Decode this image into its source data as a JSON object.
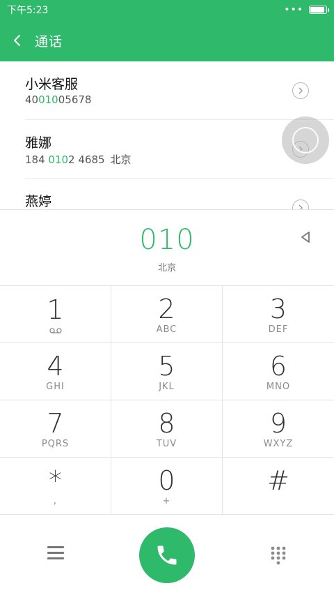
{
  "status_bar": {
    "time": "下午5:23",
    "dots": "•••",
    "battery_level": 0.85
  },
  "header": {
    "title": "通话"
  },
  "contacts": [
    {
      "name": "小米客服",
      "number_pre": "40",
      "number_hl": "010",
      "number_post": "05678",
      "location": ""
    },
    {
      "name": "雅娜",
      "number_pre": "184 ",
      "number_hl": "010",
      "number_post": "2 4685",
      "location": "北京"
    },
    {
      "name": "燕婷",
      "number_pre": "",
      "number_hl": "",
      "number_post": "",
      "location": ""
    }
  ],
  "dialed": {
    "number": "010",
    "region": "北京"
  },
  "keypad": [
    {
      "digit": "1",
      "letters": ""
    },
    {
      "digit": "2",
      "letters": "ABC"
    },
    {
      "digit": "3",
      "letters": "DEF"
    },
    {
      "digit": "4",
      "letters": "GHI"
    },
    {
      "digit": "5",
      "letters": "JKL"
    },
    {
      "digit": "6",
      "letters": "MNO"
    },
    {
      "digit": "7",
      "letters": "PQRS"
    },
    {
      "digit": "8",
      "letters": "TUV"
    },
    {
      "digit": "9",
      "letters": "WXYZ"
    },
    {
      "digit": "*",
      "letters": ","
    },
    {
      "digit": "0",
      "letters": "+"
    },
    {
      "digit": "#",
      "letters": ""
    }
  ],
  "colors": {
    "accent": "#2fb96a",
    "divider": "#e3e3e3"
  },
  "icons": {
    "back": "chevron-left-icon",
    "contact_detail": "chevron-right-circle-icon",
    "delete": "backspace-triangle-icon",
    "voicemail": "voicemail-icon",
    "menu": "hamburger-menu-icon",
    "call": "phone-icon",
    "keypad_toggle": "dialpad-icon"
  }
}
